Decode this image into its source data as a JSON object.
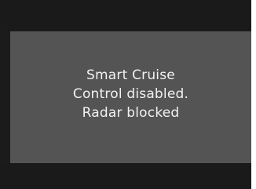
{
  "screen": {
    "message": {
      "line1": "Smart Cruise",
      "line2": "Control disabled.",
      "line3": "Radar blocked"
    }
  }
}
